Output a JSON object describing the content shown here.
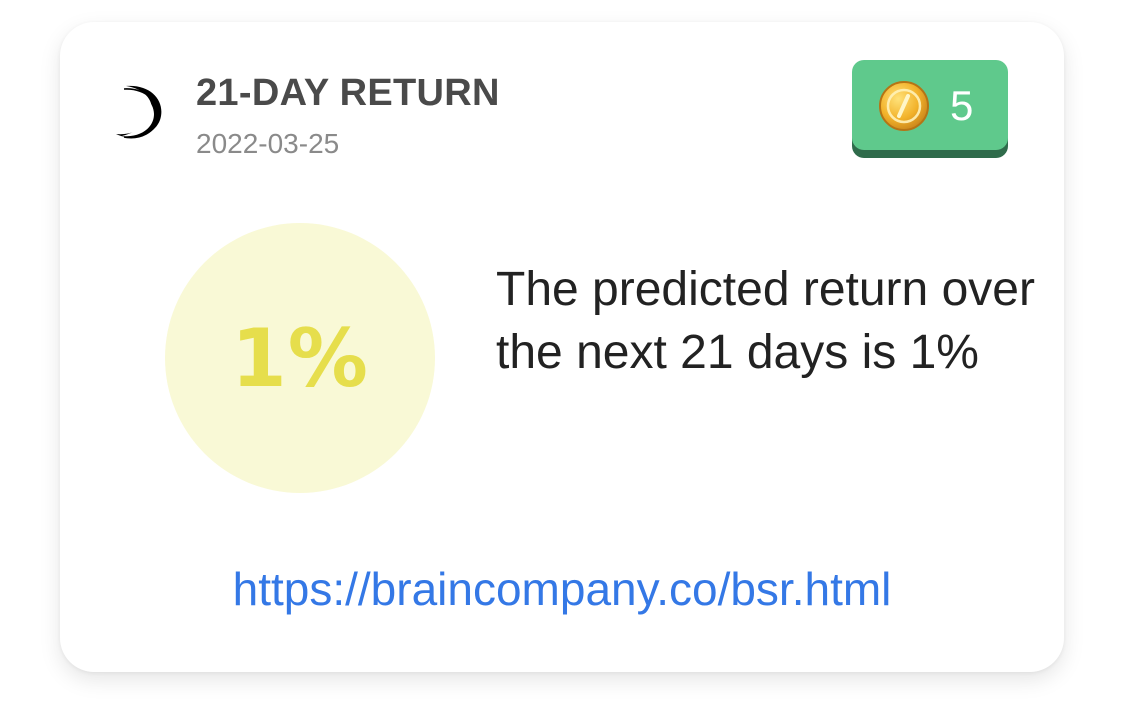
{
  "card": {
    "title": "21-DAY RETURN",
    "date": "2022-03-25",
    "logo_icon": "crescent-swirl-logo-icon",
    "coin_badge": {
      "icon": "gold-coin-icon",
      "count": "5",
      "bg_color": "#5fc98c"
    },
    "prediction": {
      "value": "1%",
      "circle_color": "#f9f9d6",
      "value_color": "#e6de4c"
    },
    "description": "The predicted return over the next 21 days is 1%",
    "link": "https://braincompany.co/bsr.html",
    "link_color": "#3478e6"
  }
}
